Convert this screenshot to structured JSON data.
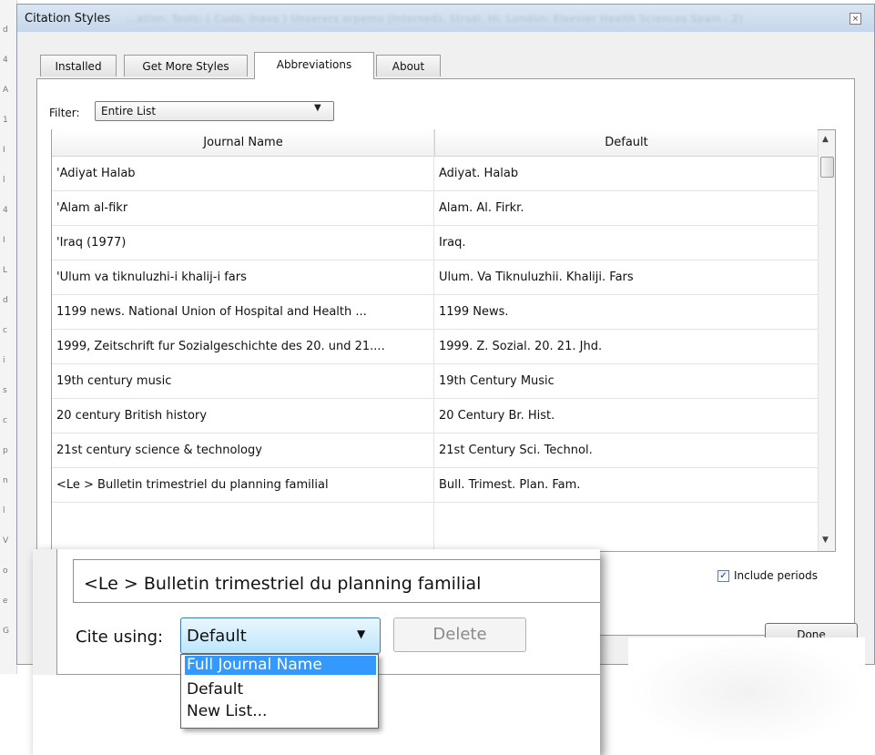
{
  "window": {
    "title": "Citation Styles",
    "close_icon": "×"
  },
  "background_title_blur": "…ation. Tools: ( Cudb, Inavo ) Unserers orpemo (Interned). Strsal. Hi. London: Elsevier Health Sciences Spain . 2)",
  "left_strip_chars": [
    "d",
    "4",
    "A",
    "1",
    "I",
    "l",
    "4",
    "I",
    "L",
    "d",
    "c",
    "i",
    "s",
    "c",
    "p",
    "n",
    "l",
    "V",
    "o",
    "e",
    "G"
  ],
  "tabs": [
    {
      "label": "Installed",
      "active": false
    },
    {
      "label": "Get More Styles",
      "active": false
    },
    {
      "label": "Abbreviations",
      "active": true
    },
    {
      "label": "About",
      "active": false
    }
  ],
  "filter": {
    "label": "Filter:",
    "value": "Entire List"
  },
  "table": {
    "columns": [
      "Journal Name",
      "Default"
    ],
    "rows": [
      [
        "'Adiyat Halab",
        "Adiyat. Halab"
      ],
      [
        "'Alam al-fikr",
        "Alam. Al. Firkr."
      ],
      [
        "'Iraq (1977)",
        "Iraq."
      ],
      [
        "'Ulum va tiknuluzhi-i khalij-i fars",
        "Ulum. Va Tiknuluzhii. Khaliji. Fars"
      ],
      [
        "1199 news. National Union of Hospital and Health ...",
        "1199 News."
      ],
      [
        "1999, Zeitschrift fur Sozialgeschichte des 20. und 21....",
        "1999. Z. Sozial. 20. 21. Jhd."
      ],
      [
        "19th century music",
        "19th Century Music"
      ],
      [
        "20 century British history",
        "20 Century Br. Hist."
      ],
      [
        "21st century science & technology",
        "21st Century Sci. Technol."
      ],
      [
        "<Le > Bulletin trimestriel du planning familial",
        "Bull. Trimest. Plan. Fam."
      ]
    ]
  },
  "include_periods": {
    "label": "Include periods",
    "checked": true
  },
  "done_label": "Done",
  "zoom": {
    "selected_name": "<Le > Bulletin trimestriel du planning familial",
    "cite_label": "Cite using:",
    "cite_value": "Default",
    "delete_label": "Delete",
    "options": [
      {
        "label": "Full Journal Name",
        "highlighted": true
      },
      {
        "label": "Default",
        "highlighted": false
      },
      {
        "label": "New List...",
        "highlighted": false
      }
    ]
  },
  "colors": {
    "highlight": "#3399ff",
    "window_bg": "#f0f0f0",
    "titlebar": "#c6d6ea"
  }
}
